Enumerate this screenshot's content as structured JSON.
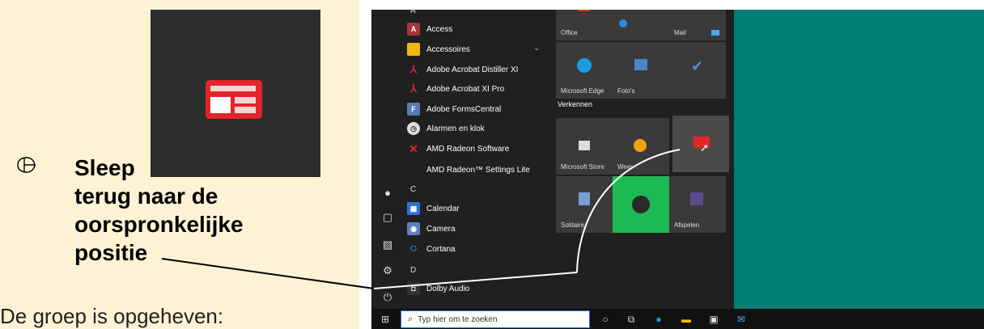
{
  "instruction": {
    "word_sleep": "Sleep",
    "rest": "terug naar de oorspronkelijke positie",
    "footer": "De groep is opgeheven:"
  },
  "start_menu": {
    "apps": [
      {
        "letter": "A"
      },
      {
        "label": "Access",
        "icon": "access-icon",
        "color": "#a4373a",
        "glyph": "A"
      },
      {
        "label": "Accessoires",
        "icon": "folder-icon",
        "color": "#f2b90c",
        "glyph": ""
      },
      {
        "label": "Adobe Acrobat Distiller XI",
        "icon": "acrobat-distiller-icon",
        "color": "#d4201f",
        "glyph": "⅄"
      },
      {
        "label": "Adobe Acrobat XI Pro",
        "icon": "acrobat-pro-icon",
        "color": "#d4201f",
        "glyph": "⅄"
      },
      {
        "label": "Adobe FormsCentral",
        "icon": "formscentral-icon",
        "color": "#5a7bb0",
        "glyph": "F"
      },
      {
        "label": "Alarmen en klok",
        "icon": "alarm-clock-icon",
        "color": "#dddddd",
        "glyph": "◷"
      },
      {
        "label": "AMD Radeon Software",
        "icon": "amd-radeon-icon",
        "color": "#e0262b",
        "glyph": "✕"
      },
      {
        "label": "AMD Radeon™ Settings Lite",
        "icon": "",
        "color": "",
        "glyph": ""
      },
      {
        "letter": "C"
      },
      {
        "label": "Calendar",
        "icon": "calendar-icon",
        "color": "#2f6fd6",
        "glyph": "▦"
      },
      {
        "label": "Camera",
        "icon": "camera-icon",
        "color": "#5c7fbf",
        "glyph": "◉"
      },
      {
        "label": "Cortana",
        "icon": "cortana-icon",
        "color": "#202020",
        "glyph": "○"
      },
      {
        "letter": "D"
      },
      {
        "label": "Dolby Audio",
        "icon": "dolby-icon",
        "color": "#333333",
        "glyph": "◘"
      }
    ],
    "section_label": "Verkennen",
    "tiles": {
      "office": "Office",
      "mail": "Mail",
      "edge": "Microsoft Edge",
      "photos": "Foto's",
      "store": "Microsoft Store",
      "weather": "Weer",
      "solitaire": "Solitaire",
      "play": "Afspelen"
    }
  },
  "taskbar": {
    "search_placeholder": "Typ hier om te zoeken"
  },
  "colors": {
    "panel_bg": "#fdf2d3",
    "desktop": "#007f74",
    "news_red": "#e0262b"
  }
}
